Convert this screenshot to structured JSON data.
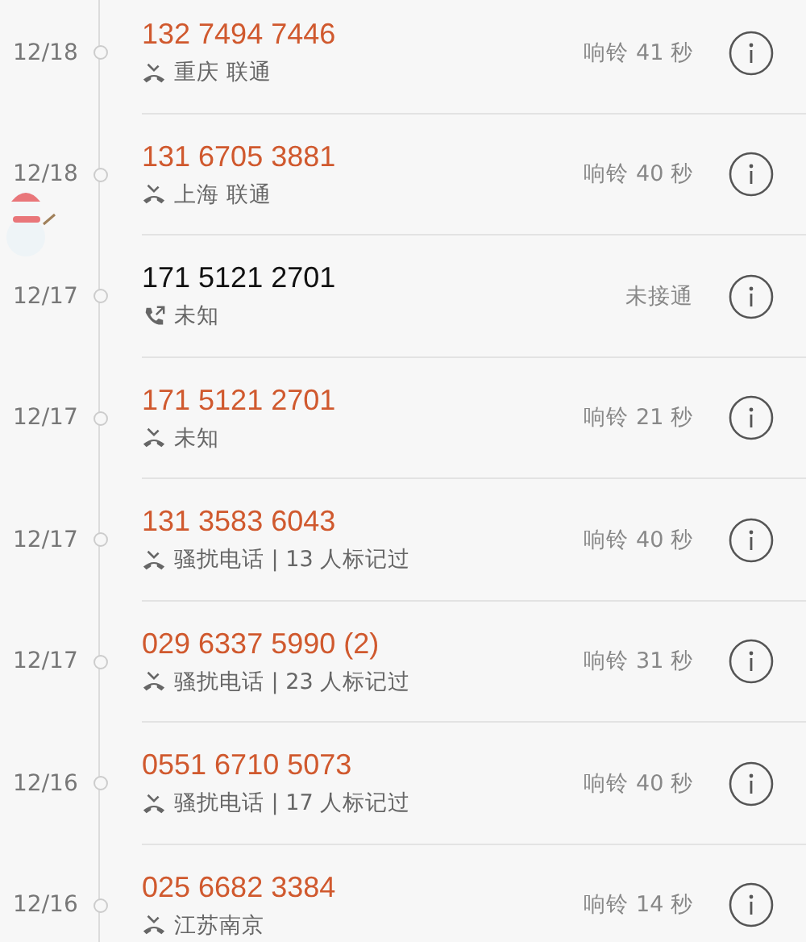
{
  "calls": [
    {
      "date": "12/18",
      "number": "132 7494 7446",
      "kind": "missed",
      "detail": "重庆 联通",
      "status": "响铃 41 秒"
    },
    {
      "date": "12/18",
      "number": "131 6705 3881",
      "kind": "missed",
      "detail": "上海 联通",
      "status": "响铃 40 秒"
    },
    {
      "date": "12/17",
      "number": "171 5121 2701",
      "kind": "outgoing",
      "detail": "未知",
      "status": "未接通"
    },
    {
      "date": "12/17",
      "number": "171 5121 2701",
      "kind": "missed",
      "detail": "未知",
      "status": "响铃 21 秒"
    },
    {
      "date": "12/17",
      "number": "131 3583 6043",
      "kind": "missed",
      "detail": "骚扰电话 | 13 人标记过",
      "status": "响铃 40 秒"
    },
    {
      "date": "12/17",
      "number": "029 6337 5990 (2)",
      "kind": "missed",
      "detail": "骚扰电话 | 23 人标记过",
      "status": "响铃 31 秒"
    },
    {
      "date": "12/16",
      "number": "0551 6710 5073",
      "kind": "missed",
      "detail": "骚扰电话 | 17 人标记过",
      "status": "响铃 40 秒"
    },
    {
      "date": "12/16",
      "number": "025 6682 3384",
      "kind": "missed",
      "detail": "江苏南京",
      "status": "响铃 14 秒"
    }
  ]
}
